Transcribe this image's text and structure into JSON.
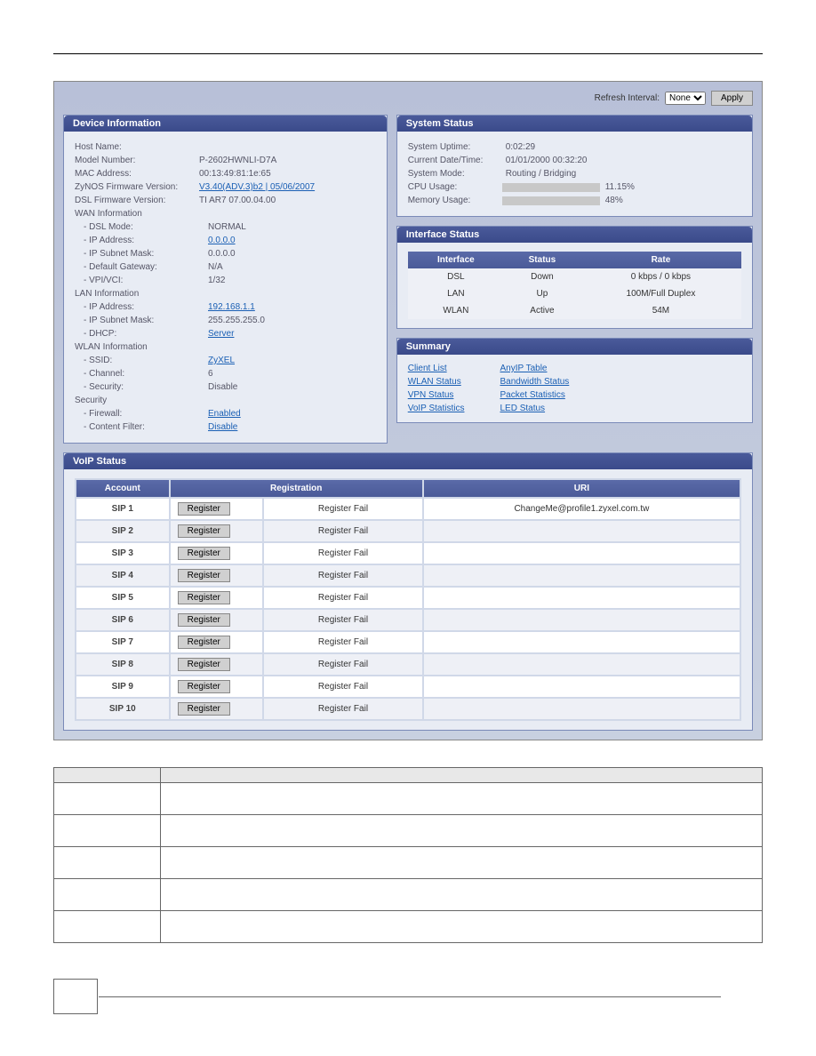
{
  "topbar": {
    "refreshLabel": "Refresh Interval:",
    "refreshSelected": "None",
    "applyLabel": "Apply"
  },
  "deviceInfo": {
    "title": "Device Information",
    "rows": {
      "hostName": {
        "label": "Host Name:",
        "value": ""
      },
      "modelNumber": {
        "label": "Model Number:",
        "value": "P-2602HWNLI-D7A"
      },
      "macAddress": {
        "label": "MAC Address:",
        "value": "00:13:49:81:1e:65"
      },
      "zynosFw": {
        "label": "ZyNOS Firmware Version:",
        "value": "V3.40(ADV.3)b2 | 05/06/2007",
        "link": true
      },
      "dslFw": {
        "label": "DSL Firmware Version:",
        "value": "TI AR7 07.00.04.00"
      }
    },
    "wanSection": "WAN Information",
    "wan": {
      "dslMode": {
        "label": "- DSL Mode:",
        "value": "NORMAL"
      },
      "ipAddress": {
        "label": "- IP Address:",
        "value": "0.0.0.0",
        "link": true
      },
      "ipSubnet": {
        "label": "- IP Subnet Mask:",
        "value": "0.0.0.0"
      },
      "defaultGw": {
        "label": "- Default Gateway:",
        "value": "N/A"
      },
      "vpivci": {
        "label": "- VPI/VCI:",
        "value": "1/32"
      }
    },
    "lanSection": "LAN Information",
    "lan": {
      "ipAddress": {
        "label": "- IP Address:",
        "value": "192.168.1.1",
        "link": true
      },
      "ipSubnet": {
        "label": "- IP Subnet Mask:",
        "value": "255.255.255.0"
      },
      "dhcp": {
        "label": "- DHCP:",
        "value": "Server",
        "link": true
      }
    },
    "wlanSection": "WLAN Information",
    "wlan": {
      "ssid": {
        "label": "- SSID:",
        "value": "ZyXEL",
        "link": true
      },
      "channel": {
        "label": "- Channel:",
        "value": "6"
      },
      "security": {
        "label": "- Security:",
        "value": "Disable"
      }
    },
    "secSection": "Security",
    "security": {
      "firewall": {
        "label": "- Firewall:",
        "value": "Enabled",
        "link": true
      },
      "contentFilter": {
        "label": "- Content Filter:",
        "value": "Disable",
        "link": true
      }
    }
  },
  "systemStatus": {
    "title": "System Status",
    "uptime": {
      "label": "System Uptime:",
      "value": "0:02:29"
    },
    "datetime": {
      "label": "Current Date/Time:",
      "value": "01/01/2000 00:32:20"
    },
    "mode": {
      "label": "System Mode:",
      "value": "Routing / Bridging"
    },
    "cpu": {
      "label": "CPU Usage:",
      "value": "11.15%",
      "pct": 11.15
    },
    "mem": {
      "label": "Memory Usage:",
      "value": "48%",
      "pct": 48
    }
  },
  "interfaceStatus": {
    "title": "Interface Status",
    "headers": [
      "Interface",
      "Status",
      "Rate"
    ],
    "rows": [
      {
        "iface": "DSL",
        "status": "Down",
        "rate": "0 kbps / 0 kbps"
      },
      {
        "iface": "LAN",
        "status": "Up",
        "rate": "100M/Full Duplex"
      },
      {
        "iface": "WLAN",
        "status": "Active",
        "rate": "54M"
      }
    ]
  },
  "summary": {
    "title": "Summary",
    "col1": [
      "Client List",
      "WLAN Status",
      "VPN Status",
      "VoIP Statistics"
    ],
    "col2": [
      "AnyIP Table",
      "Bandwidth Status",
      "Packet Statistics",
      "LED Status"
    ]
  },
  "voip": {
    "title": "VoIP Status",
    "headers": [
      "Account",
      "Registration",
      "URI"
    ],
    "registerBtn": "Register",
    "rows": [
      {
        "acct": "SIP 1",
        "status": "Register Fail",
        "uri": "ChangeMe@profile1.zyxel.com.tw"
      },
      {
        "acct": "SIP 2",
        "status": "Register Fail",
        "uri": ""
      },
      {
        "acct": "SIP 3",
        "status": "Register Fail",
        "uri": ""
      },
      {
        "acct": "SIP 4",
        "status": "Register Fail",
        "uri": ""
      },
      {
        "acct": "SIP 5",
        "status": "Register Fail",
        "uri": ""
      },
      {
        "acct": "SIP 6",
        "status": "Register Fail",
        "uri": ""
      },
      {
        "acct": "SIP 7",
        "status": "Register Fail",
        "uri": ""
      },
      {
        "acct": "SIP 8",
        "status": "Register Fail",
        "uri": ""
      },
      {
        "acct": "SIP 9",
        "status": "Register Fail",
        "uri": ""
      },
      {
        "acct": "SIP 10",
        "status": "Register Fail",
        "uri": ""
      }
    ]
  },
  "descTable": {
    "rows": [
      {
        "label": "",
        "desc": ""
      },
      {
        "label": "",
        "desc": ""
      },
      {
        "label": "",
        "desc": ""
      },
      {
        "label": "",
        "desc": ""
      },
      {
        "label": "",
        "desc": ""
      }
    ]
  }
}
